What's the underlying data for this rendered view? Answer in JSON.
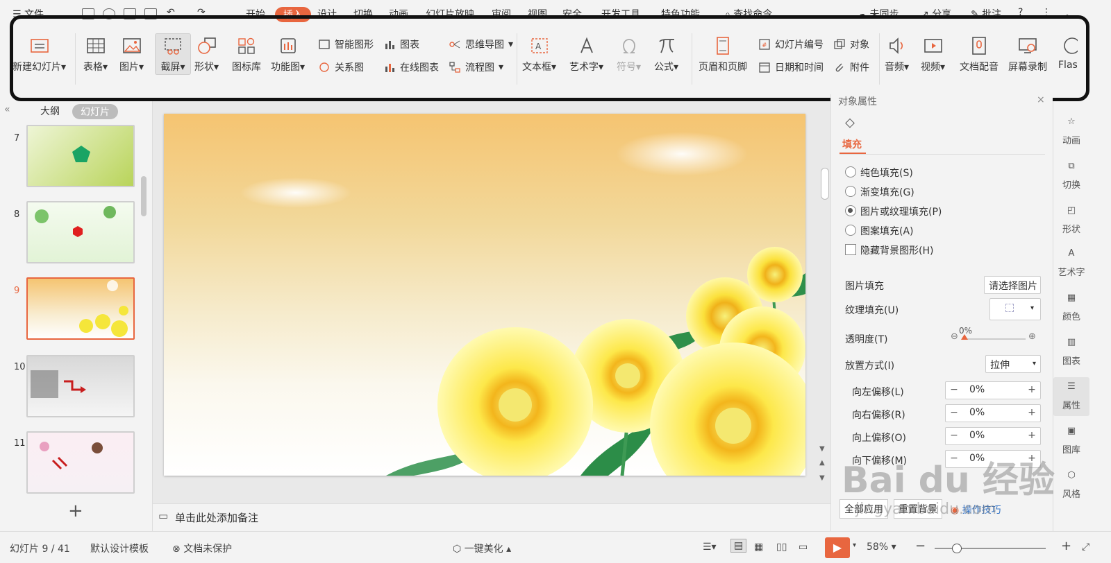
{
  "menu": {
    "file": "文件",
    "tabs": [
      "开始",
      "插入",
      "设计",
      "切换",
      "动画",
      "幻灯片放映",
      "审阅",
      "视图",
      "安全",
      "开发工具",
      "特色功能"
    ],
    "active_tab": "插入",
    "search": "查找命令",
    "sync": "未同步",
    "share": "分享",
    "comment": "批注"
  },
  "ribbon": {
    "new_slide": "新建幻灯片",
    "table": "表格",
    "picture": "图片",
    "screenshot": "截屏",
    "shape": "形状",
    "icon_lib": "图标库",
    "function_chart": "功能图",
    "smart_art": "智能图形",
    "chart": "图表",
    "relation": "关系图",
    "online_chart": "在线图表",
    "mindmap": "思维导图",
    "flowchart": "流程图",
    "textbox": "文本框",
    "wordart": "艺术字",
    "symbol": "符号",
    "formula": "公式",
    "header_footer": "页眉和页脚",
    "slide_number": "幻灯片编号",
    "datetime": "日期和时间",
    "object": "对象",
    "attachment": "附件",
    "audio": "音频",
    "video": "视频",
    "doc_dub": "文档配音",
    "screen_record": "屏幕录制",
    "flash": "Flas"
  },
  "left_panel": {
    "tab_outline": "大纲",
    "tab_slides": "幻灯片",
    "slides": [
      "7",
      "8",
      "9",
      "10",
      "11"
    ],
    "current": "9",
    "add": "+"
  },
  "notes": {
    "placeholder": "单击此处添加备注"
  },
  "props": {
    "header": "对象属性",
    "tab_fill": "填充",
    "options": [
      "纯色填充(S)",
      "渐变填充(G)",
      "图片或纹理填充(P)",
      "图案填充(A)"
    ],
    "hide_bg": "隐藏背景图形(H)",
    "pic_fill_label": "图片填充",
    "pic_fill_value": "请选择图片",
    "texture_label": "纹理填充(U)",
    "transparency_label": "透明度(T)",
    "transparency_value": "0%",
    "transparency": 0,
    "placement_label": "放置方式(I)",
    "placement_value": "拉伸",
    "offsets": [
      {
        "label": "向左偏移(L)",
        "value": "0%"
      },
      {
        "label": "向右偏移(R)",
        "value": "0%"
      },
      {
        "label": "向上偏移(O)",
        "value": "0%"
      },
      {
        "label": "向下偏移(M)",
        "value": "0%"
      }
    ],
    "apply_all": "全部应用",
    "reset_bg": "重置背景",
    "tips": "操作技巧"
  },
  "sidebar": [
    "动画",
    "切换",
    "形状",
    "艺术字",
    "颜色",
    "图表",
    "属性",
    "图库",
    "风格"
  ],
  "status": {
    "slide_info": "幻灯片 9 / 41",
    "template": "默认设计模板",
    "protect": "文档未保护",
    "beautify": "一键美化",
    "zoom": "58%",
    "zoom_level": 0.58
  },
  "watermark": {
    "logo": "Bai du 经验",
    "url": "jingyan.baidu.com"
  },
  "colors": {
    "accent": "#e8663f",
    "frame": "#111111"
  }
}
